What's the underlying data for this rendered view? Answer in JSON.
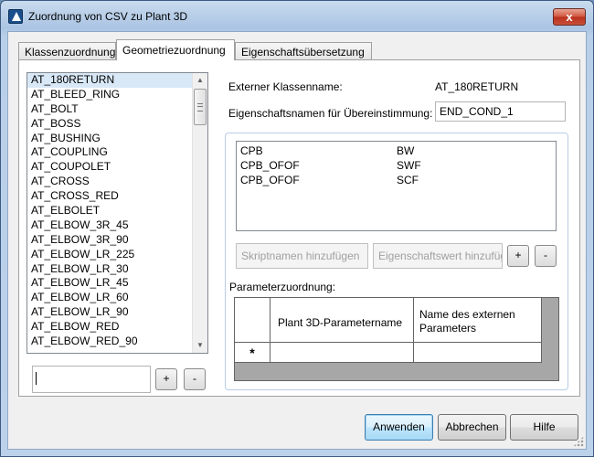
{
  "window": {
    "title": "Zuordnung von CSV zu Plant 3D",
    "close_label": "x"
  },
  "tabs": [
    {
      "label": "Klassenzuordnung"
    },
    {
      "label": "Geometriezuordnung"
    },
    {
      "label": "Eigenschaftsübersetzung"
    }
  ],
  "class_list": {
    "selected": "AT_180RETURN",
    "items": [
      "AT_180RETURN",
      "AT_BLEED_RING",
      "AT_BOLT",
      "AT_BOSS",
      "AT_BUSHING",
      "AT_COUPLING",
      "AT_COUPOLET",
      "AT_CROSS",
      "AT_CROSS_RED",
      "AT_ELBOLET",
      "AT_ELBOW_3R_45",
      "AT_ELBOW_3R_90",
      "AT_ELBOW_LR_225",
      "AT_ELBOW_LR_30",
      "AT_ELBOW_LR_45",
      "AT_ELBOW_LR_60",
      "AT_ELBOW_LR_90",
      "AT_ELBOW_RED",
      "AT_ELBOW_RED_90"
    ],
    "new_value": "",
    "add_label": "+",
    "remove_label": "-"
  },
  "details": {
    "external_class_label": "Externer Klassenname:",
    "external_class_value": "AT_180RETURN",
    "match_property_label": "Eigenschaftsnamen für Übereinstimmung:",
    "match_property_value": "END_COND_1"
  },
  "mapping": {
    "rows": [
      {
        "a": "CPB",
        "b": "BW"
      },
      {
        "a": "CPB_OFOF",
        "b": "SWF"
      },
      {
        "a": "CPB_OFOF",
        "b": "SCF"
      }
    ],
    "add_script_label": "Skriptnamen hinzufügen",
    "add_property_value_label": "Eigenschaftswert hinzufüg",
    "add_label": "+",
    "remove_label": "-"
  },
  "parameters": {
    "label": "Parameterzuordnung:",
    "col1": "Plant 3D-Parametername",
    "col2": "Name des externen Parameters",
    "new_row_marker": "*"
  },
  "buttons": {
    "apply": "Anwenden",
    "cancel": "Abbrechen",
    "help": "Hilfe"
  }
}
